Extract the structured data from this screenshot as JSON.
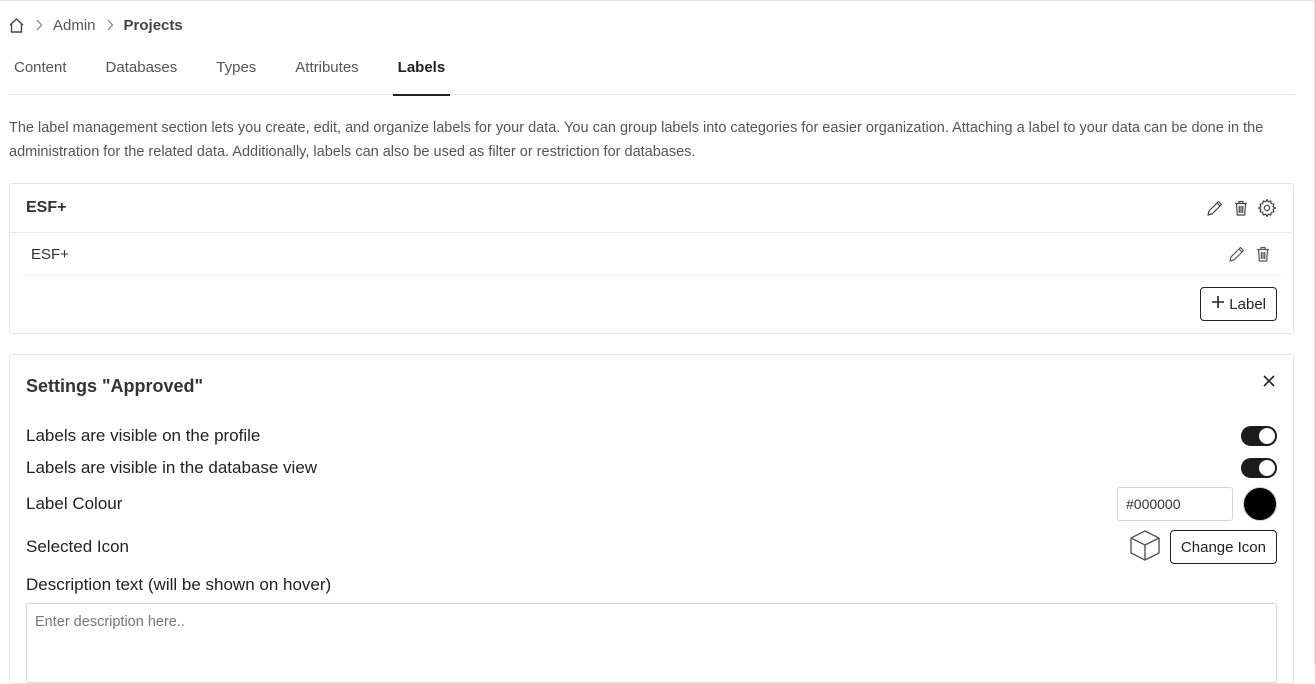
{
  "breadcrumb": {
    "items": [
      "Admin",
      "Projects"
    ]
  },
  "tabs": [
    {
      "label": "Content",
      "active": false
    },
    {
      "label": "Databases",
      "active": false
    },
    {
      "label": "Types",
      "active": false
    },
    {
      "label": "Attributes",
      "active": false
    },
    {
      "label": "Labels",
      "active": true
    }
  ],
  "intro_text": "The label management section lets you create, edit, and organize labels for your data. You can group labels into categories for easier organization. Attaching a label to your data can be done in the administration for the related data. Additionally, labels can also be used as filter or restriction for databases.",
  "category": {
    "title": "ESF+",
    "labels": [
      {
        "name": "ESF+"
      }
    ],
    "add_button_label": "Label"
  },
  "settings": {
    "title": "Settings \"Approved\"",
    "visible_on_profile_label": "Labels are visible on the profile",
    "visible_on_profile": true,
    "visible_in_db_label": "Labels are visible in the database view",
    "visible_in_db": true,
    "colour_label": "Label Colour",
    "colour_value": "#000000",
    "icon_label": "Selected Icon",
    "selected_icon": "cube-icon",
    "change_icon_button": "Change Icon",
    "description_label": "Description text (will be shown on hover)",
    "description_placeholder": "Enter description here.."
  }
}
